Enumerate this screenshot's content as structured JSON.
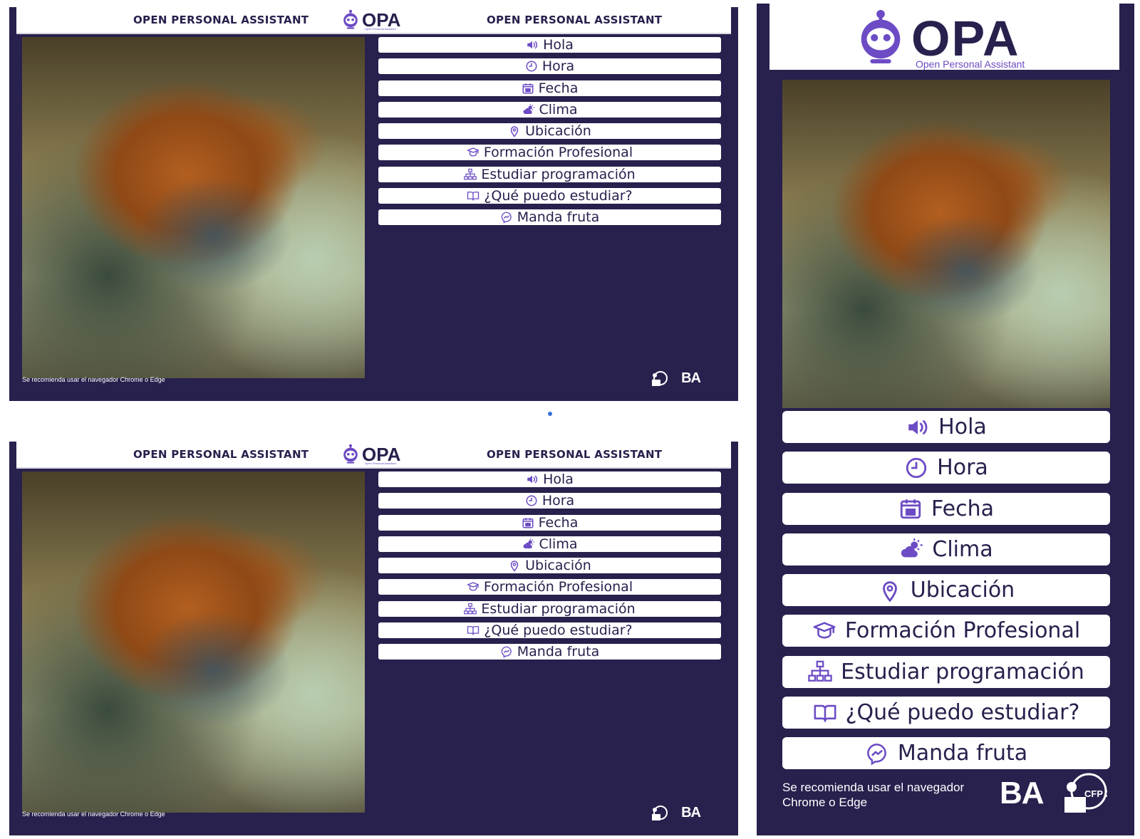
{
  "header": {
    "left_title": "OPEN PERSONAL ASSISTANT",
    "right_title": "OPEN PERSONAL ASSISTANT"
  },
  "logo": {
    "word": "OPA",
    "subtitle": "Open Personal Assistant"
  },
  "menu": [
    {
      "label": "Hola",
      "icon": "speaker-icon"
    },
    {
      "label": "Hora",
      "icon": "clock-icon"
    },
    {
      "label": "Fecha",
      "icon": "calendar-icon"
    },
    {
      "label": "Clima",
      "icon": "weather-icon"
    },
    {
      "label": "Ubicación",
      "icon": "location-pin-icon"
    },
    {
      "label": "Formación Profesional",
      "icon": "graduation-cap-icon"
    },
    {
      "label": "Estudiar programación",
      "icon": "sitemap-icon"
    },
    {
      "label": "¿Qué puedo estudiar?",
      "icon": "open-book-icon"
    },
    {
      "label": "Manda fruta",
      "icon": "messenger-icon"
    }
  ],
  "footer": {
    "note": "Se recomienda usar el navegador Chrome o Edge",
    "ba_logo": "BA",
    "seal_text": "CFP 35"
  },
  "colors": {
    "background": "#28204d",
    "accent": "#6c4bc4",
    "button": "#ffffff"
  }
}
